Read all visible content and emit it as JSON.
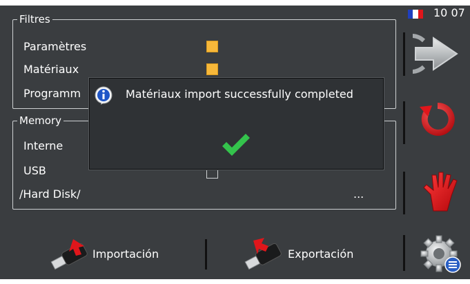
{
  "status": {
    "time": "10 07",
    "flag_icon": "france-flag-icon"
  },
  "filtres": {
    "legend": "Filtres",
    "items": [
      {
        "label": "Paramètres",
        "checked": true
      },
      {
        "label": "Matériaux",
        "checked": true
      },
      {
        "label": "Programm",
        "checked": false
      }
    ]
  },
  "memory": {
    "legend": "Memory",
    "items": [
      {
        "label": "Interne"
      },
      {
        "label": "USB",
        "checked": false
      }
    ],
    "path": "/Hard Disk/",
    "browse_label": "..."
  },
  "dialog": {
    "icon": "info-icon",
    "message": "Matériaux import successfully completed",
    "confirm_icon": "checkmark-icon"
  },
  "bottom": {
    "import_label": "Importación",
    "export_label": "Exportación"
  },
  "side": {
    "icons": [
      "next-arrow-icon",
      "refresh-circle-icon",
      "stop-hand-icon",
      "settings-gear-icon"
    ]
  },
  "colors": {
    "checkbox_on": "#f7b83a",
    "check_green": "#34c34c",
    "background": "#3a3d40",
    "accent_red": "#e0161b"
  }
}
